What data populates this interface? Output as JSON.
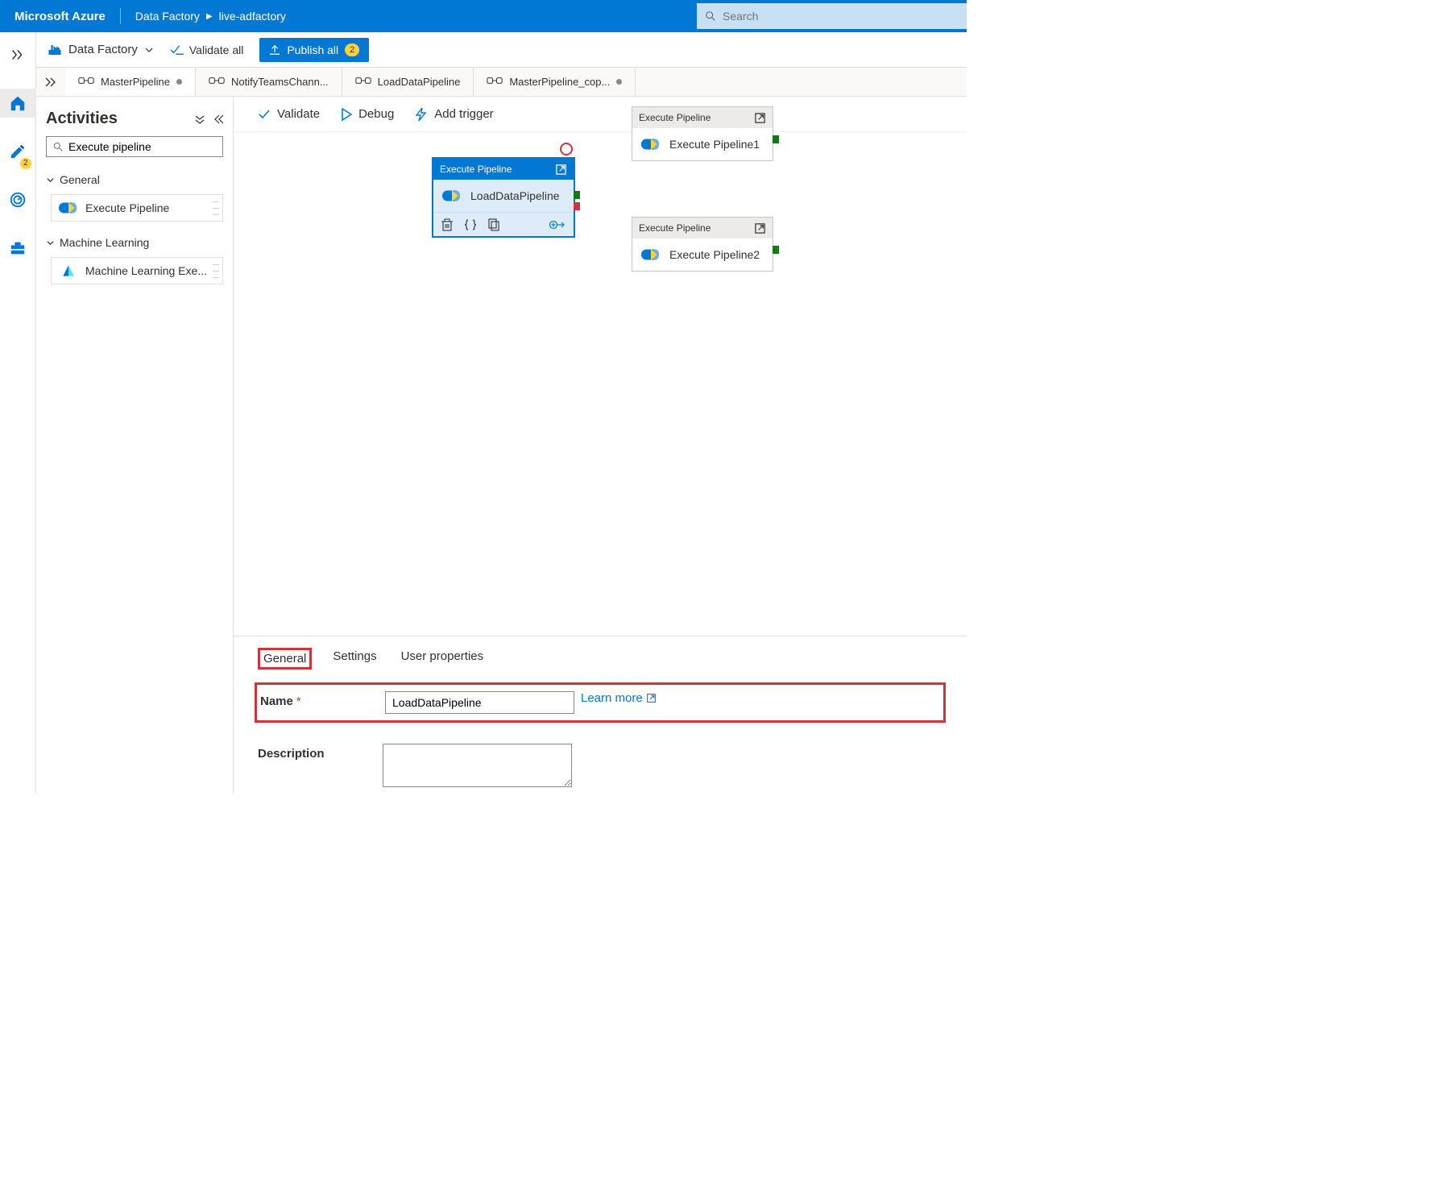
{
  "header": {
    "logo": "Microsoft Azure",
    "crumb1": "Data Factory",
    "crumb2": "live-adfactory",
    "search_placeholder": "Search"
  },
  "rail": {
    "pencil_badge": "2"
  },
  "toolbar": {
    "df_label": "Data Factory",
    "validate_all": "Validate all",
    "publish_all": "Publish all",
    "publish_count": "2"
  },
  "tabs": [
    {
      "label": "MasterPipeline",
      "dirty": true,
      "active": true
    },
    {
      "label": "NotifyTeamsChann...",
      "dirty": false,
      "active": false
    },
    {
      "label": "LoadDataPipeline",
      "dirty": false,
      "active": false
    },
    {
      "label": "MasterPipeline_cop...",
      "dirty": true,
      "active": false
    }
  ],
  "activities": {
    "title": "Activities",
    "search_value": "Execute pipeline",
    "groups": [
      {
        "name": "General",
        "items": [
          "Execute Pipeline"
        ]
      },
      {
        "name": "Machine Learning",
        "items": [
          "Machine Learning Exe..."
        ]
      }
    ]
  },
  "canvas_toolbar": {
    "validate": "Validate",
    "debug": "Debug",
    "add_trigger": "Add trigger"
  },
  "nodes": {
    "selected": {
      "type": "Execute Pipeline",
      "title": "LoadDataPipeline"
    },
    "n1": {
      "type": "Execute Pipeline",
      "title": "Execute Pipeline1"
    },
    "n2": {
      "type": "Execute Pipeline",
      "title": "Execute Pipeline2"
    }
  },
  "props": {
    "tabs": {
      "general": "General",
      "settings": "Settings",
      "user": "User properties"
    },
    "name_label": "Name",
    "name_value": "LoadDataPipeline",
    "desc_label": "Description",
    "desc_value": "",
    "learn_more": "Learn more"
  }
}
